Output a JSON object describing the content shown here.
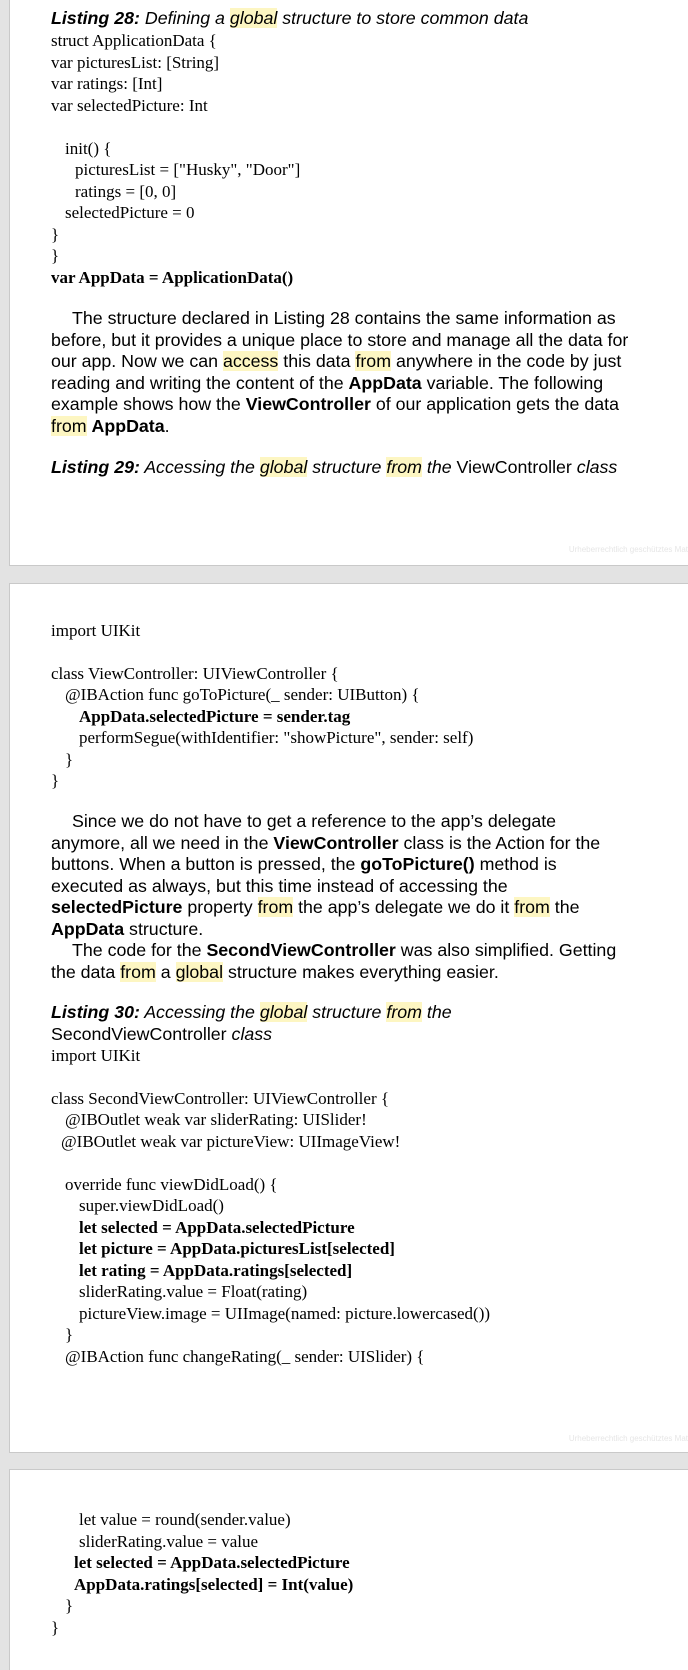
{
  "watermark": "Urheberrechtlich geschütztes Mat",
  "page1": {
    "listing28": {
      "label": "Listing 28:",
      "pre": " Defining a ",
      "hl": "global",
      "post": " structure to store common data"
    },
    "code": [
      "struct ApplicationData {",
      "var picturesList: [String]",
      "var ratings: [Int]",
      "var selectedPicture: Int",
      "init() {",
      "picturesList = [\"Husky\", \"Door\"]",
      "ratings = [0, 0]",
      "selectedPicture = 0",
      "}",
      "}",
      "var AppData = ApplicationData()"
    ],
    "para": {
      "l1": "The structure declared in Listing 28 contains the same information as",
      "l2": "before, but it provides a unique place to store and manage all the data for",
      "l3a": "our app. Now we can ",
      "l3b": "access",
      "l3c": " this data ",
      "l3d": "from",
      "l3e": " anywhere in the code by just",
      "l4a": "reading and writing the content of the ",
      "l4b": "AppData",
      "l4c": " variable. The following",
      "l5a": "example shows how the ",
      "l5b": "ViewController",
      "l5c": " of our application gets the data",
      "l6a": "from",
      "l6b": " ",
      "l6c": "AppData",
      "l6d": "."
    },
    "listing29": {
      "label": "Listing 29:",
      "a": " Accessing the ",
      "b": "global",
      "c": " structure ",
      "d": "from",
      "e": " the ",
      "f": "ViewController",
      "g": " class"
    }
  },
  "page2": {
    "code1": [
      "import UIKit",
      "class ViewController: UIViewController {",
      "@IBAction func goToPicture(_ sender: UIButton) {",
      "AppData.selectedPicture = sender.tag",
      "performSegue(withIdentifier: \"showPicture\", sender: self)",
      "}",
      "}"
    ],
    "para": {
      "l1": "Since we do not have to get a reference to the app’s delegate",
      "l2a": "anymore, all we need in the ",
      "l2b": "ViewController",
      "l2c": " class is the Action for the",
      "l3a": "buttons. When a button is pressed, the ",
      "l3b": "goToPicture()",
      "l3c": " method is",
      "l4": "executed as always, but this time instead of accessing the",
      "l5a": "selectedPicture",
      "l5b": " property ",
      "l5c": "from",
      "l5d": " the app’s delegate we do it ",
      "l5e": "from",
      "l5f": " the",
      "l6a": "AppData",
      "l6b": " structure.",
      "l7a": "The code for the ",
      "l7b": "SecondViewController",
      "l7c": " was also simplified. Getting",
      "l8a": "the data ",
      "l8b": "from",
      "l8c": " a ",
      "l8d": "global",
      "l8e": " structure makes everything easier."
    },
    "listing30": {
      "label": "Listing 30:",
      "a": " Accessing the ",
      "b": "global",
      "c": " structure ",
      "d": "from",
      "e": " the",
      "f": "SecondViewController",
      "g": " class"
    },
    "code2": [
      "import UIKit",
      "class SecondViewController: UIViewController {",
      "@IBOutlet weak var sliderRating: UISlider!",
      "@IBOutlet weak var pictureView: UIImageView!",
      "override func viewDidLoad() {",
      "super.viewDidLoad()",
      "let selected = AppData.selectedPicture",
      "let picture = AppData.picturesList[selected]",
      "let rating = AppData.ratings[selected]",
      "sliderRating.value = Float(rating)",
      "pictureView.image = UIImage(named: picture.lowercased())",
      "}",
      "@IBAction func changeRating(_ sender: UISlider) {"
    ]
  },
  "page3": {
    "code": [
      "let value = round(sender.value)",
      "sliderRating.value = value",
      "let selected = AppData.selectedPicture",
      "AppData.ratings[selected] = Int(value)",
      "}",
      "}"
    ]
  }
}
